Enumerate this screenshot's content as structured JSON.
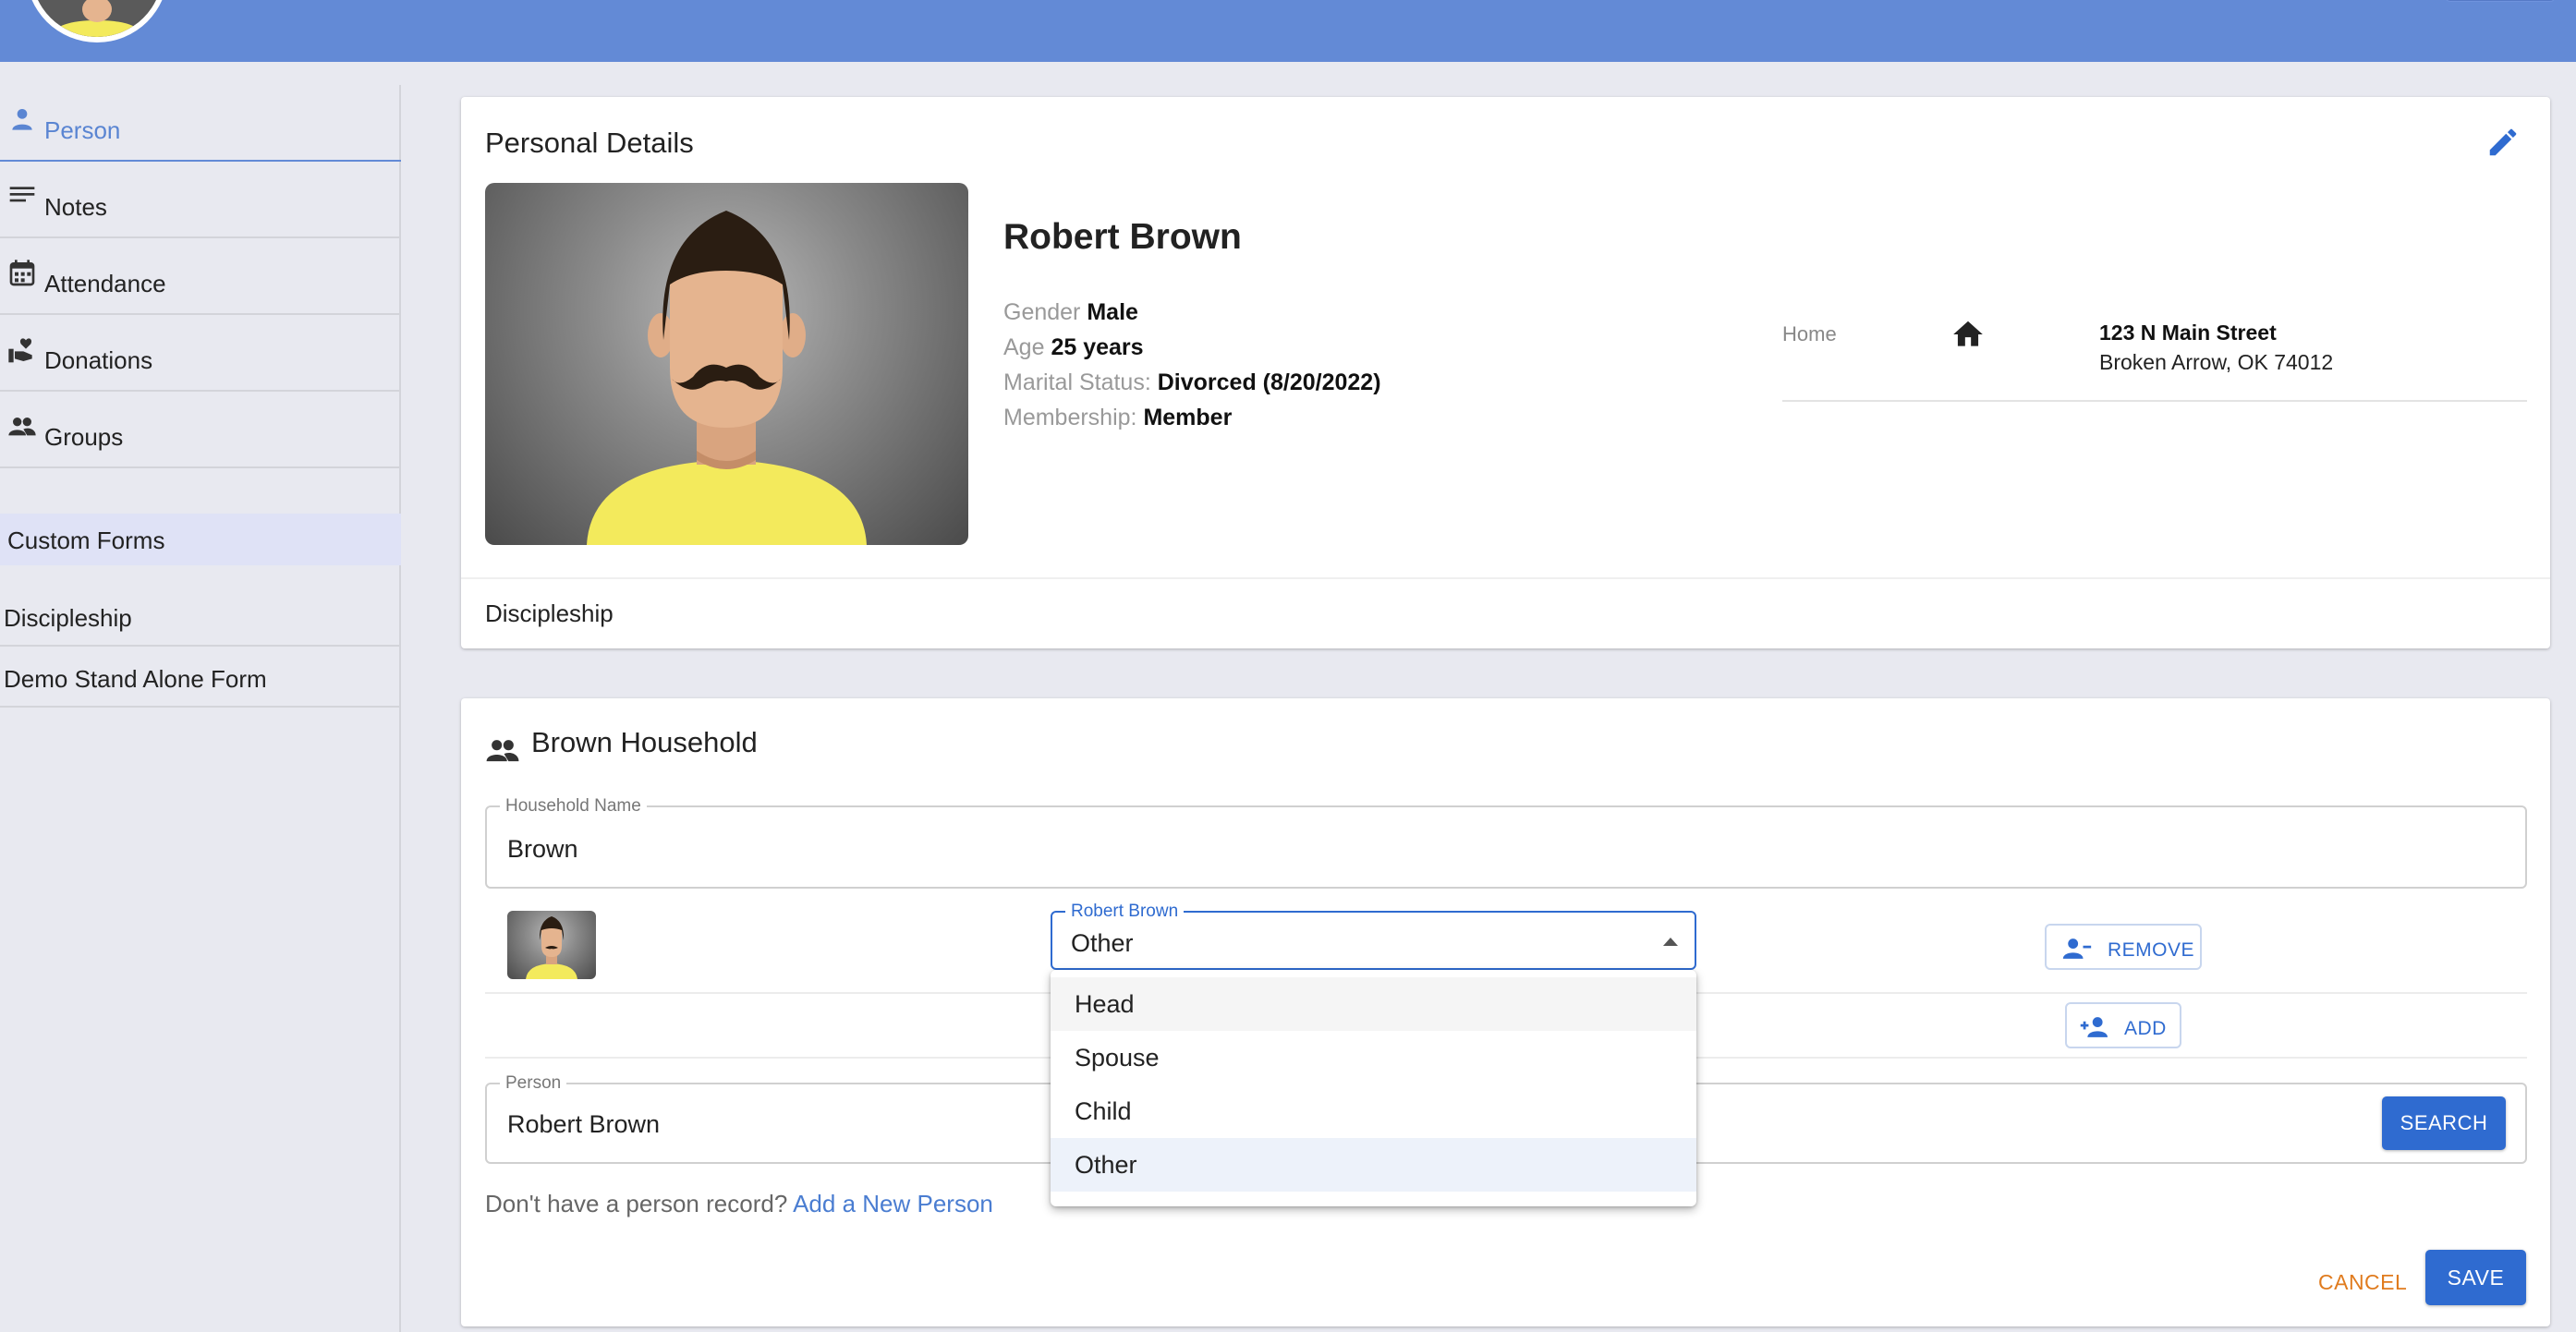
{
  "sidebar": {
    "items": [
      {
        "label": "Person",
        "icon": "person-icon",
        "active": true
      },
      {
        "label": "Notes",
        "icon": "notes-icon"
      },
      {
        "label": "Attendance",
        "icon": "calendar-icon"
      },
      {
        "label": "Donations",
        "icon": "donation-icon"
      },
      {
        "label": "Groups",
        "icon": "groups-icon"
      }
    ],
    "section_header": "Custom Forms",
    "forms": [
      "Discipleship",
      "Demo Stand Alone Form"
    ]
  },
  "personal": {
    "title": "Personal Details",
    "name": "Robert Brown",
    "gender_label": "Gender",
    "gender": "Male",
    "age_label": "Age",
    "age": "25 years",
    "marital_label": "Marital Status:",
    "marital": "Divorced (8/20/2022)",
    "membership_label": "Membership:",
    "membership": "Member",
    "address_type": "Home",
    "address_line1": "123 N Main Street",
    "address_line2": "Broken Arrow, OK 74012",
    "footer_link": "Discipleship"
  },
  "household": {
    "title": "Brown Household",
    "name_label": "Household Name",
    "name_value": "Brown",
    "member_label": "Robert Brown",
    "member_role": "Other",
    "remove_label": "REMOVE",
    "add_label": "ADD",
    "person_label": "Person",
    "person_value": "Robert Brown",
    "search_label": "SEARCH",
    "no_record_text": "Don't have a person record?",
    "add_new_link": "Add a New Person",
    "cancel_label": "CANCEL",
    "save_label": "SAVE"
  },
  "dropdown": {
    "options": [
      "Head",
      "Spouse",
      "Child",
      "Other"
    ],
    "selected": "Other"
  },
  "colors": {
    "header": "#638ad6",
    "primary": "#2f6bd0",
    "cancel": "#e07b1e",
    "accent_link": "#4a7dd1"
  }
}
